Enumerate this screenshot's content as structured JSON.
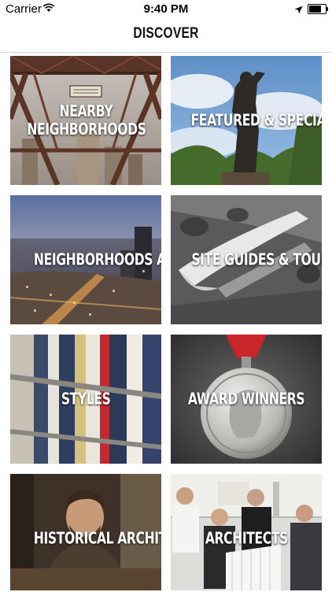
{
  "status_bar": {
    "carrier": "Carrier",
    "time": "9:40 PM"
  },
  "nav": {
    "title": "DISCOVER"
  },
  "tiles": [
    {
      "label_line1": "NEARBY",
      "label_line2": "NEIGHBORHOODS"
    },
    {
      "label_line1": "FEATURED & SPECIAL"
    },
    {
      "label_line1": "NEIGHBORHOODS A TO Z"
    },
    {
      "label_line1": "SITE GUIDES & TOURS"
    },
    {
      "label_line1": "STYLES"
    },
    {
      "label_line1": "AWARD WINNERS"
    },
    {
      "label_line1": "HISTORICAL ARCHITECTS"
    },
    {
      "label_line1": "ARCHITECTS"
    }
  ],
  "icons": [
    "wifi-icon",
    "location-arrow-icon",
    "battery-icon"
  ]
}
